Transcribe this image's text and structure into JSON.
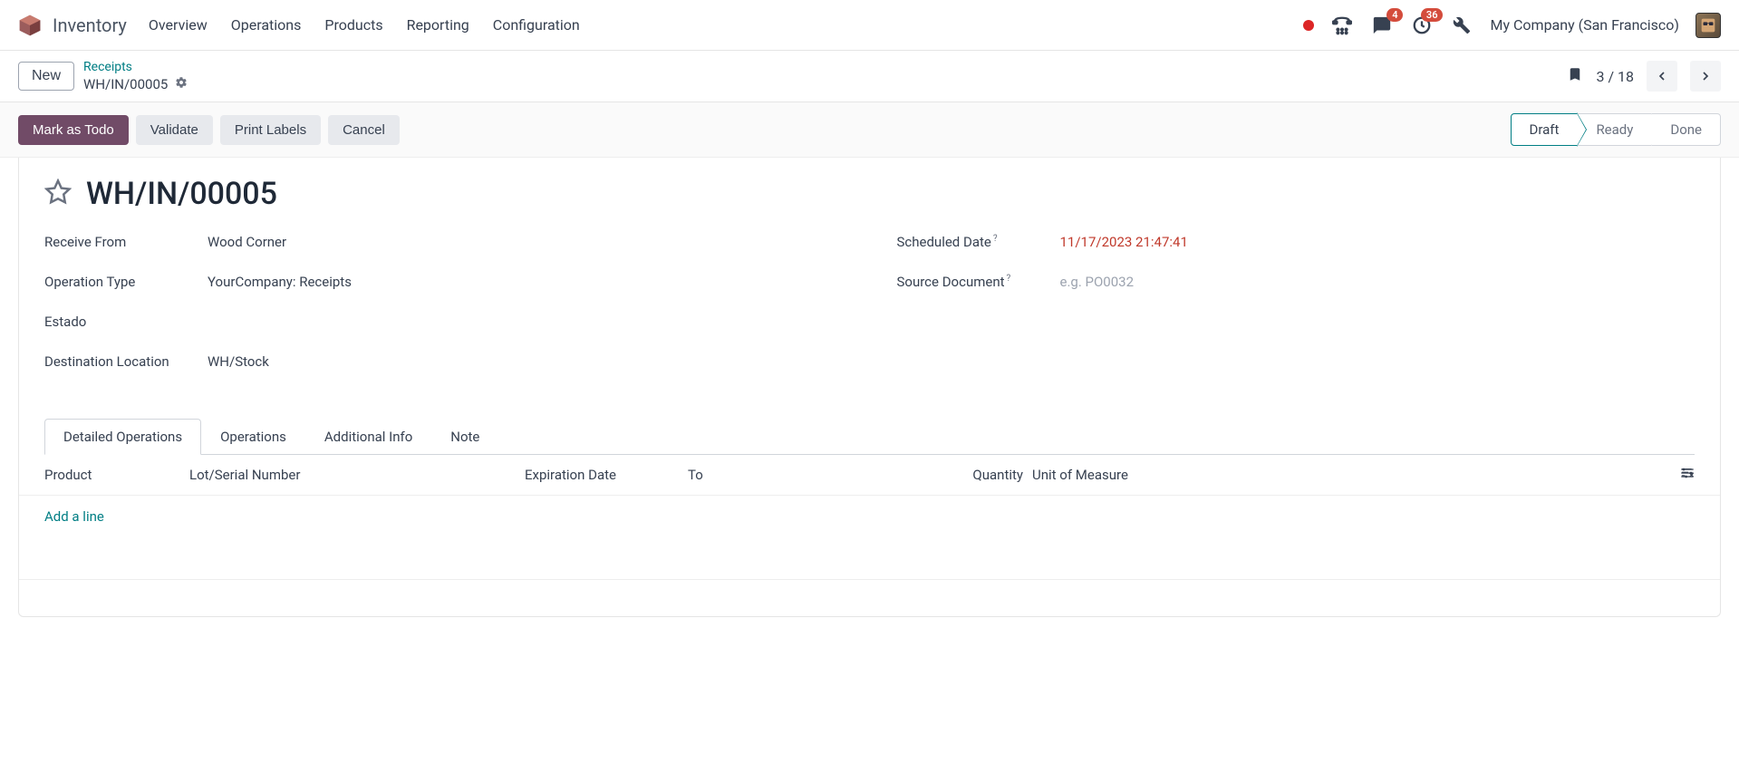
{
  "app_name": "Inventory",
  "topnav": {
    "overview": "Overview",
    "operations": "Operations",
    "products": "Products",
    "reporting": "Reporting",
    "configuration": "Configuration"
  },
  "badges": {
    "messages": "4",
    "activities": "36"
  },
  "company": "My Company (San Francisco)",
  "new_btn": "New",
  "breadcrumb": {
    "parent": "Receipts",
    "current": "WH/IN/00005"
  },
  "pager": {
    "text": "3 / 18"
  },
  "actions": {
    "mark_todo": "Mark as Todo",
    "validate": "Validate",
    "print_labels": "Print Labels",
    "cancel": "Cancel"
  },
  "status": {
    "draft": "Draft",
    "ready": "Ready",
    "done": "Done"
  },
  "title": "WH/IN/00005",
  "fields": {
    "receive_from_label": "Receive From",
    "receive_from_value": "Wood Corner",
    "operation_type_label": "Operation Type",
    "operation_type_value": "YourCompany: Receipts",
    "estado_label": "Estado",
    "destination_label": "Destination Location",
    "destination_value": "WH/Stock",
    "scheduled_date_label": "Scheduled Date",
    "scheduled_date_value": "11/17/2023 21:47:41",
    "source_doc_label": "Source Document",
    "source_doc_placeholder": "e.g. PO0032"
  },
  "tabs": {
    "detailed": "Detailed Operations",
    "operations": "Operations",
    "additional": "Additional Info",
    "note": "Note"
  },
  "columns": {
    "product": "Product",
    "lot": "Lot/Serial Number",
    "expiration": "Expiration Date",
    "to": "To",
    "quantity": "Quantity",
    "uom": "Unit of Measure"
  },
  "add_line": "Add a line"
}
